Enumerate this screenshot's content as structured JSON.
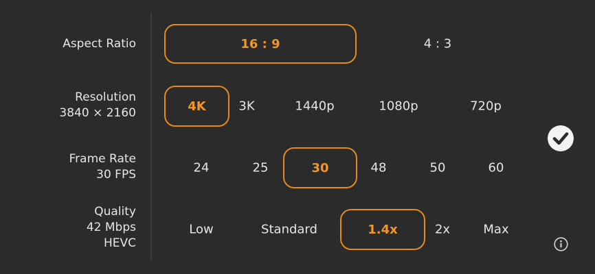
{
  "aspect_ratio": {
    "label": "Aspect Ratio",
    "options": [
      "16 : 9",
      "4 : 3"
    ],
    "selected": "16 : 9"
  },
  "resolution": {
    "label": "Resolution",
    "value": "3840 × 2160",
    "options": [
      "4K",
      "3K",
      "1440p",
      "1080p",
      "720p"
    ],
    "selected": "4K"
  },
  "frame_rate": {
    "label": "Frame Rate",
    "value": "30 FPS",
    "options": [
      "24",
      "25",
      "30",
      "48",
      "50",
      "60"
    ],
    "selected": "30"
  },
  "quality": {
    "label": "Quality",
    "value": "42 Mbps",
    "codec": "HEVC",
    "options": [
      "Low",
      "Standard",
      "1.4x",
      "2x",
      "Max"
    ],
    "selected": "1.4x"
  },
  "icons": {
    "confirm": "checkmark-circle-icon",
    "info": "info-icon"
  },
  "colors": {
    "background": "#2b2b2b",
    "accent": "#e88a1a",
    "text": "#e6e6e6"
  }
}
